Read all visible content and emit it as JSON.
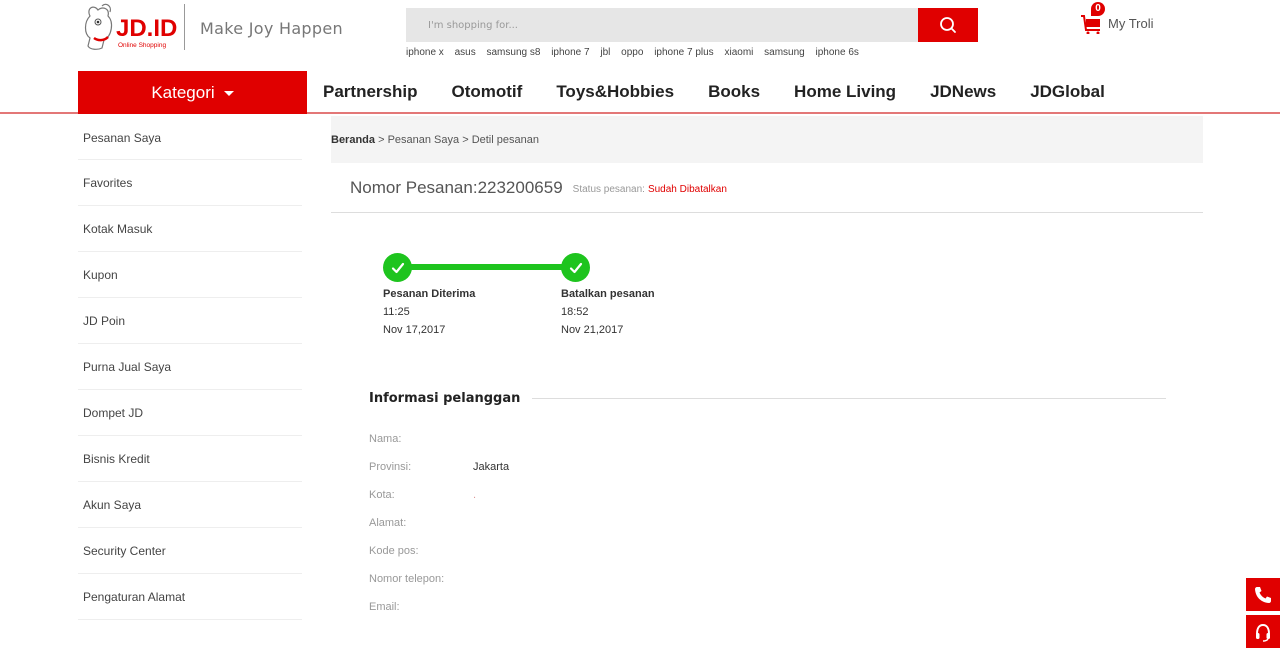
{
  "header": {
    "logo": {
      "brand": "JD.ID",
      "sub": "Online Shopping"
    },
    "slogan": "Make Joy Happen",
    "search": {
      "placeholder": "I'm shopping for...",
      "value": ""
    },
    "hot_words": [
      "iphone x",
      "asus",
      "samsung s8",
      "iphone 7",
      "jbl",
      "oppo",
      "iphone 7 plus",
      "xiaomi",
      "samsung",
      "iphone 6s"
    ],
    "cart": {
      "label": "My Troli",
      "count": "0"
    }
  },
  "nav": {
    "kategori": "Kategori",
    "links": [
      "Partnership",
      "Otomotif",
      "Toys&Hobbies",
      "Books",
      "Home Living",
      "JDNews",
      "JDGlobal"
    ]
  },
  "sidebar": {
    "items": [
      "Pesanan Saya",
      "Favorites",
      "Kotak Masuk",
      "Kupon",
      "JD Poin",
      "Purna Jual Saya",
      "Dompet JD",
      "Bisnis Kredit",
      "Akun Saya",
      "Security Center",
      "Pengaturan Alamat"
    ]
  },
  "breadcrumb": {
    "home": "Beranda",
    "sep": " > ",
    "level1": "Pesanan Saya",
    "level2": "Detil pesanan"
  },
  "order": {
    "number_label": "Nomor Pesanan:223200659",
    "status_label": "Status pesanan:",
    "status_value": "Sudah Dibatalkan"
  },
  "progress": {
    "steps": [
      {
        "title": "Pesanan Diterima",
        "time": "11:25",
        "date": "Nov 17,2017",
        "done": true
      },
      {
        "title": "Batalkan pesanan",
        "time": "18:52",
        "date": "Nov 21,2017",
        "done": true
      }
    ]
  },
  "customer_info": {
    "title": "Informasi pelanggan",
    "fields": [
      {
        "label": "Nama:",
        "value": ""
      },
      {
        "label": "Provinsi:",
        "value": "Jakarta"
      },
      {
        "label": "Kota:",
        "value": "."
      },
      {
        "label": "Alamat:",
        "value": ""
      },
      {
        "label": "Kode pos:",
        "value": ""
      },
      {
        "label": "Nomor telepon:",
        "value": ""
      },
      {
        "label": "Email:",
        "value": ""
      }
    ]
  },
  "floating": {
    "icons": [
      "phone-icon",
      "headset-icon"
    ]
  },
  "colors": {
    "brand_red": "#e00000",
    "success_green": "#1ec41e"
  }
}
